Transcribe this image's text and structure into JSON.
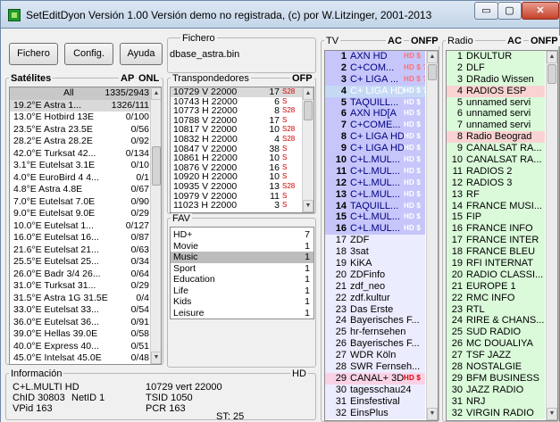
{
  "window": {
    "title": "SetEditDyon Versión  1.00  Versión demo no registrada, (c) por W.Litzinger, 2001-2013",
    "min_glyph": "▭",
    "max_glyph": "▢",
    "close_glyph": "✕"
  },
  "toolbar": {
    "fichero": "Fichero",
    "config": "Config.",
    "ayuda": "Ayuda"
  },
  "file": {
    "label": "Fichero",
    "value": "dbase_astra.bin"
  },
  "satellites": {
    "title": "Satélites",
    "flags": "AP",
    "flags2": "ONL",
    "selected_index": 1,
    "items": [
      [
        "All",
        "1335/2943"
      ],
      [
        "19.2°E Astra 1...",
        "1326/111"
      ],
      [
        "13.0°E Hotbird 13E",
        "0/100"
      ],
      [
        "23.5°E Astra 23.5E",
        "0/56"
      ],
      [
        "28.2°E Astra 28.2E",
        "0/92"
      ],
      [
        "42.0°E Turksat 42...",
        "0/134"
      ],
      [
        "3.1°E Eutelsat 3.1E",
        "0/10"
      ],
      [
        "4.0°E EuroBird 4 4...",
        "0/1"
      ],
      [
        "4.8°E Astra 4.8E",
        "0/67"
      ],
      [
        "7.0°E Eutelsat 7.0E",
        "0/90"
      ],
      [
        "9.0°E Eutelsat 9.0E",
        "0/29"
      ],
      [
        "10.0°E Eutelsat 1...",
        "0/127"
      ],
      [
        "16.0°E Eutelsat 16...",
        "0/87"
      ],
      [
        "21.6°E Eutelsat 21...",
        "0/63"
      ],
      [
        "25.5°E Eutelsat 25...",
        "0/34"
      ],
      [
        "26.0°E Badr 3/4 26...",
        "0/64"
      ],
      [
        "31.0°E Turksat 31...",
        "0/29"
      ],
      [
        "31.5°E Astra 1G 31.5E",
        "0/4"
      ],
      [
        "33.0°E Eutelsat 33...",
        "0/54"
      ],
      [
        "36.0°E Eutelsat 36...",
        "0/91"
      ],
      [
        "39.0°E Hellas 39.0E",
        "0/58"
      ],
      [
        "40.0°E Express 40...",
        "0/51"
      ],
      [
        "45.0°E Intelsat 45.0E",
        "0/48"
      ]
    ]
  },
  "transponders": {
    "title": "Transpondedores",
    "flags": "OFP",
    "selected_index": 0,
    "items": [
      [
        "10729 V 22000",
        "17",
        "S28"
      ],
      [
        "10743 H 22000",
        "6",
        "S"
      ],
      [
        "10773 H 22000",
        "8",
        "S28"
      ],
      [
        "10788 V 22000",
        "17",
        "S"
      ],
      [
        "10817 V 22000",
        "10",
        "S28"
      ],
      [
        "10832 H 22000",
        "4",
        "S28"
      ],
      [
        "10847 V 22000",
        "38",
        "S"
      ],
      [
        "10861 H 22000",
        "10",
        "S"
      ],
      [
        "10876 V 22000",
        "16",
        "S"
      ],
      [
        "10920 H 22000",
        "10",
        "S"
      ],
      [
        "10935 V 22000",
        "13",
        "S28"
      ],
      [
        "10979 V 22000",
        "11",
        "S"
      ],
      [
        "11023 H 22000",
        "3",
        "S"
      ]
    ]
  },
  "fav": {
    "title": "FAV",
    "selected_index": 2,
    "items": [
      [
        "HD+",
        "7"
      ],
      [
        "Movie",
        "1"
      ],
      [
        "Music",
        "1"
      ],
      [
        "Sport",
        "1"
      ],
      [
        "Education",
        "1"
      ],
      [
        "Life",
        "1"
      ],
      [
        "Kids",
        "1"
      ],
      [
        "Leisure",
        "1"
      ]
    ]
  },
  "tv": {
    "title": "TV",
    "flags": "AC",
    "flags2": "ONFP",
    "items": [
      [
        "1",
        "AXN HD",
        "HD $"
      ],
      [
        "2",
        "C+COM...",
        "HD $ ?"
      ],
      [
        "3",
        "C+ LIGA ...",
        "HD $ ?"
      ],
      [
        "4",
        "C+ LIGA HD",
        "HD $ ?"
      ],
      [
        "5",
        "TAQUILL...",
        "HD $"
      ],
      [
        "6",
        "AXN HD[A",
        "HD $"
      ],
      [
        "7",
        "C+COME...",
        "HD $"
      ],
      [
        "8",
        "C+ LIGA HD",
        "HD $"
      ],
      [
        "9",
        "C+ LIGA HD",
        "HD $"
      ],
      [
        "10",
        "C+L.MUL...",
        "HD $"
      ],
      [
        "11",
        "C+L.MUL...",
        "HD $"
      ],
      [
        "12",
        "C+L.MUL...",
        "HD $"
      ],
      [
        "13",
        "C+L.MUL...",
        "HD $"
      ],
      [
        "14",
        "TAQUILL...",
        "HD $"
      ],
      [
        "15",
        "C+L.MUL...",
        "HD $"
      ],
      [
        "16",
        "C+L.MUL...",
        "HD $"
      ],
      [
        "17",
        "ZDF",
        ""
      ],
      [
        "18",
        "3sat",
        ""
      ],
      [
        "19",
        "KiKA",
        ""
      ],
      [
        "20",
        "ZDFinfo",
        ""
      ],
      [
        "21",
        "zdf_neo",
        ""
      ],
      [
        "22",
        "zdf.kultur",
        ""
      ],
      [
        "23",
        "Das Erste",
        ""
      ],
      [
        "24",
        "Bayerisches F...",
        ""
      ],
      [
        "25",
        "hr-fernsehen",
        ""
      ],
      [
        "26",
        "Bayerisches F...",
        ""
      ],
      [
        "27",
        "WDR Köln",
        ""
      ],
      [
        "28",
        "SWR Fernseh...",
        ""
      ],
      [
        "29",
        "CANAL+ 3D",
        "HD $"
      ],
      [
        "30",
        "tagesschau24",
        ""
      ],
      [
        "31",
        "Einsfestival",
        ""
      ],
      [
        "32",
        "EinsPlus",
        ""
      ]
    ]
  },
  "radio": {
    "title": "Radio",
    "flags": "AC",
    "flags2": "ONFP",
    "items": [
      [
        "1",
        "DKULTUR"
      ],
      [
        "2",
        "DLF"
      ],
      [
        "3",
        "DRadio Wissen"
      ],
      [
        "4",
        "RADIOS ESP"
      ],
      [
        "5",
        "unnamed servi"
      ],
      [
        "6",
        "unnamed servi"
      ],
      [
        "7",
        "unnamed servi"
      ],
      [
        "8",
        "Radio Beograd"
      ],
      [
        "9",
        "CANALSAT RA..."
      ],
      [
        "10",
        "CANALSAT RA..."
      ],
      [
        "11",
        "RADIOS 2"
      ],
      [
        "12",
        "RADIOS 3"
      ],
      [
        "13",
        "RF"
      ],
      [
        "14",
        "FRANCE MUSI..."
      ],
      [
        "15",
        "FIP"
      ],
      [
        "16",
        "FRANCE INFO"
      ],
      [
        "17",
        "FRANCE INTER"
      ],
      [
        "18",
        "FRANCE BLEU"
      ],
      [
        "19",
        "RFI INTERNAT"
      ],
      [
        "20",
        "RADIO CLASSI..."
      ],
      [
        "21",
        "EUROPE 1"
      ],
      [
        "22",
        "RMC INFO"
      ],
      [
        "23",
        "RTL"
      ],
      [
        "24",
        "RIRE & CHANS..."
      ],
      [
        "25",
        "SUD RADIO"
      ],
      [
        "26",
        "MC DOUALIYA"
      ],
      [
        "27",
        "TSF JAZZ"
      ],
      [
        "28",
        "NOSTALGIE"
      ],
      [
        "29",
        "BFM BUSINESS"
      ],
      [
        "30",
        "JAZZ RADIO"
      ],
      [
        "31",
        "NRJ"
      ],
      [
        "32",
        "VIRGIN RADIO"
      ]
    ]
  },
  "info": {
    "title": "Información",
    "tag": "HD",
    "name": "C+L.MULTI HD",
    "freq": "10729  vert 22000",
    "chid": "ChID 30803",
    "netid": "NetID 1",
    "tsid": "TSID 1050",
    "vpid": "VPid 163",
    "pcr": "PCR 163",
    "st": "ST: 25"
  },
  "colors": {
    "tv_blue": "#c6c6fb",
    "tv_selected": "#c5d9f5",
    "tv_other": "#ececff",
    "radio_green": "#dafada",
    "radio_pink": "#fad2d2",
    "hd_red": "#e00000"
  }
}
